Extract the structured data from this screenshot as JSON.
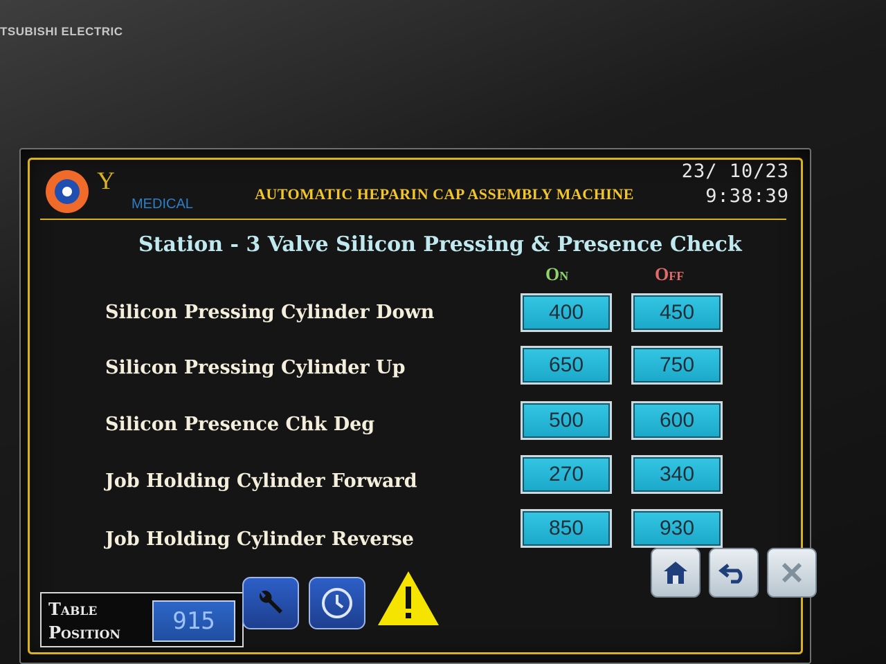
{
  "device": {
    "brand": "TSUBISHI ELECTRIC"
  },
  "header": {
    "logo_text": "Y",
    "logo_sub": "MEDICAL",
    "machine_title": "AUTOMATIC HEPARIN CAP ASSEMBLY MACHINE",
    "date": "23/ 10/23",
    "time": "9:38:39"
  },
  "station": {
    "title": "Station - 3 Valve Silicon Pressing & Presence Check",
    "on_label": "On",
    "off_label": "Off"
  },
  "rows": [
    {
      "label": "Silicon Pressing Cylinder Down",
      "on": "400",
      "off": "450"
    },
    {
      "label": "Silicon Pressing Cylinder Up",
      "on": "650",
      "off": "750"
    },
    {
      "label": "Silicon Presence Chk Deg",
      "on": "500",
      "off": "600"
    },
    {
      "label": "Job Holding Cylinder Forward",
      "on": "270",
      "off": "340"
    },
    {
      "label": "Job Holding Cylinder Reverse",
      "on": "850",
      "off": "930"
    }
  ],
  "footer": {
    "table_position_label": "Table Position",
    "table_position_value": "915"
  },
  "icons": {
    "home": "home-icon",
    "back": "back-icon",
    "close": "close-icon",
    "wrench": "wrench-icon",
    "clock": "clock-icon",
    "warning": "warning-icon"
  },
  "colors": {
    "accent": "#d9b21f",
    "value_box": "#1aa8c9",
    "on": "#8fd36a",
    "off": "#e36a6a"
  }
}
